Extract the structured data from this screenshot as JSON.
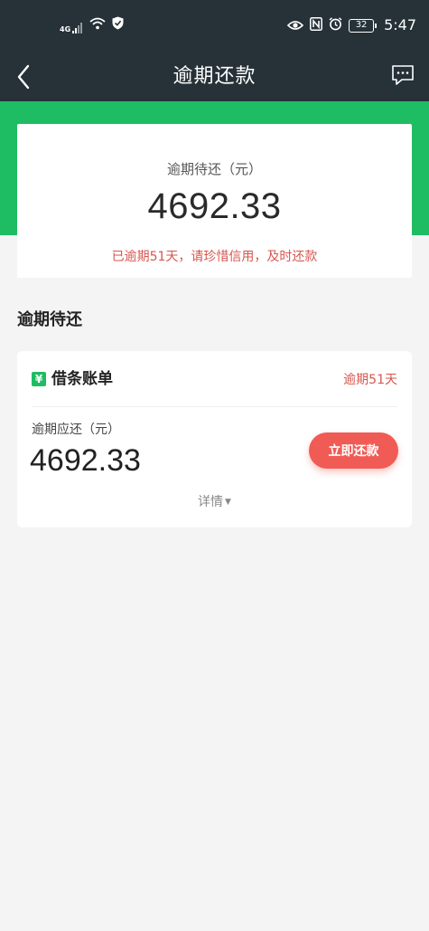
{
  "status_bar": {
    "network_label": "4G",
    "battery_level": "32",
    "time": "5:47"
  },
  "nav": {
    "title": "逾期还款"
  },
  "summary": {
    "label": "逾期待还（元）",
    "amount": "4692.33",
    "warning": "已逾期51天，请珍惜信用，及时还款"
  },
  "section": {
    "title": "逾期待还"
  },
  "bill": {
    "name": "借条账单",
    "overdue_status": "逾期51天",
    "due_label": "逾期应还（元）",
    "due_amount": "4692.33",
    "pay_button": "立即还款",
    "details_label": "详情"
  },
  "colors": {
    "header_dark": "#263238",
    "brand_green": "#1fbd63",
    "alert_red": "#d6564f",
    "button_red": "#f05c55",
    "background": "#f4f4f4"
  }
}
